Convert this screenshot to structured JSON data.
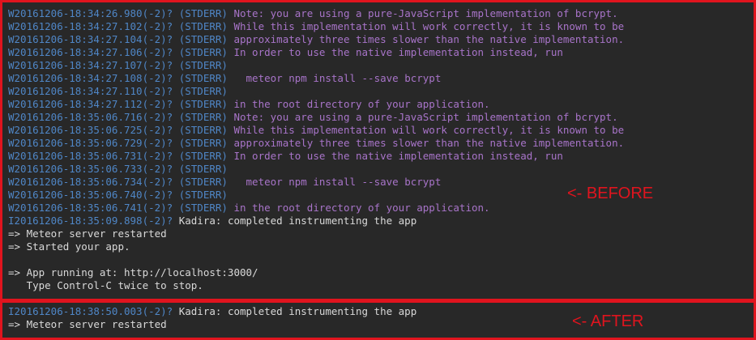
{
  "before_log": [
    {
      "ts": "W20161206-18:34:26.980(-2)?",
      "stream": "(STDERR)",
      "msg": "Note: you are using a pure-JavaScript implementation of bcrypt.",
      "kind": "purple"
    },
    {
      "ts": "W20161206-18:34:27.102(-2)?",
      "stream": "(STDERR)",
      "msg": "While this implementation will work correctly, it is known to be",
      "kind": "purple"
    },
    {
      "ts": "W20161206-18:34:27.104(-2)?",
      "stream": "(STDERR)",
      "msg": "approximately three times slower than the native implementation.",
      "kind": "purple"
    },
    {
      "ts": "W20161206-18:34:27.106(-2)?",
      "stream": "(STDERR)",
      "msg": "In order to use the native implementation instead, run",
      "kind": "purple"
    },
    {
      "ts": "W20161206-18:34:27.107(-2)?",
      "stream": "(STDERR)",
      "msg": "",
      "kind": "purple"
    },
    {
      "ts": "W20161206-18:34:27.108(-2)?",
      "stream": "(STDERR)",
      "msg": "  meteor npm install --save bcrypt",
      "kind": "purple"
    },
    {
      "ts": "W20161206-18:34:27.110(-2)?",
      "stream": "(STDERR)",
      "msg": "",
      "kind": "purple"
    },
    {
      "ts": "W20161206-18:34:27.112(-2)?",
      "stream": "(STDERR)",
      "msg": "in the root directory of your application.",
      "kind": "purple"
    },
    {
      "ts": "W20161206-18:35:06.716(-2)?",
      "stream": "(STDERR)",
      "msg": "Note: you are using a pure-JavaScript implementation of bcrypt.",
      "kind": "purple"
    },
    {
      "ts": "W20161206-18:35:06.725(-2)?",
      "stream": "(STDERR)",
      "msg": "While this implementation will work correctly, it is known to be",
      "kind": "purple"
    },
    {
      "ts": "W20161206-18:35:06.729(-2)?",
      "stream": "(STDERR)",
      "msg": "approximately three times slower than the native implementation.",
      "kind": "purple"
    },
    {
      "ts": "W20161206-18:35:06.731(-2)?",
      "stream": "(STDERR)",
      "msg": "In order to use the native implementation instead, run",
      "kind": "purple"
    },
    {
      "ts": "W20161206-18:35:06.733(-2)?",
      "stream": "(STDERR)",
      "msg": "",
      "kind": "purple"
    },
    {
      "ts": "W20161206-18:35:06.734(-2)?",
      "stream": "(STDERR)",
      "msg": "  meteor npm install --save bcrypt",
      "kind": "purple"
    },
    {
      "ts": "W20161206-18:35:06.740(-2)?",
      "stream": "(STDERR)",
      "msg": "",
      "kind": "purple"
    },
    {
      "ts": "W20161206-18:35:06.741(-2)?",
      "stream": "(STDERR)",
      "msg": "in the root directory of your application.",
      "kind": "purple"
    },
    {
      "ts": "I20161206-18:35:09.898(-2)?",
      "stream": "",
      "msg": "Kadira: completed instrumenting the app",
      "kind": "white"
    },
    {
      "ts": "",
      "stream": "",
      "msg": "=> Meteor server restarted",
      "kind": "white"
    },
    {
      "ts": "",
      "stream": "",
      "msg": "=> Started your app.",
      "kind": "white"
    },
    {
      "ts": "",
      "stream": "",
      "msg": "",
      "kind": "white"
    },
    {
      "ts": "",
      "stream": "",
      "msg": "=> App running at: http://localhost:3000/",
      "kind": "white"
    },
    {
      "ts": "",
      "stream": "",
      "msg": "   Type Control-C twice to stop.",
      "kind": "white"
    }
  ],
  "after_log": [
    {
      "ts": "I20161206-18:38:50.003(-2)?",
      "stream": "",
      "msg": "Kadira: completed instrumenting the app",
      "kind": "white"
    },
    {
      "ts": "",
      "stream": "",
      "msg": "=> Meteor server restarted",
      "kind": "white"
    }
  ],
  "labels": {
    "before": "<- BEFORE",
    "after": "<- AFTER"
  },
  "colors": {
    "background": "#282828",
    "highlight_border": "#e0141e",
    "timestamp": "#4f86c6",
    "stderr_message": "#a874c9",
    "stdout_message": "#d9d9d9"
  }
}
